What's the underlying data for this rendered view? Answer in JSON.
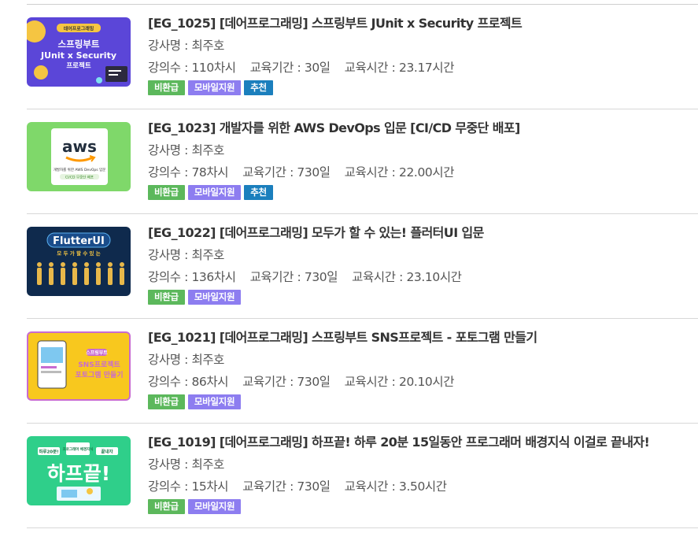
{
  "courses": [
    {
      "title": "[EG_1025] [데어프로그래밍] 스프링부트 JUnit x Security 프로젝트",
      "instructor": "강사명 : 최주호",
      "lessons": "강의수 : 110차시",
      "period": "교육기간 : 30일",
      "hours": "교육시간 : 23.17시간",
      "badges": [
        "비환급",
        "모바일지원",
        "추천"
      ],
      "thumb_text": [
        "데어프로그래밍",
        "스프링부트",
        "JUnit x Security",
        "프로젝트"
      ]
    },
    {
      "title": "[EG_1023] 개발자를 위한 AWS DevOps 입문 [CI/CD 무중단 배포]",
      "instructor": "강사명 : 최주호",
      "lessons": "강의수 : 78차시",
      "period": "교육기간 : 730일",
      "hours": "교육시간 : 22.00시간",
      "badges": [
        "비환급",
        "모바일지원",
        "추천"
      ],
      "thumb_text": [
        "aws",
        "개발자를 위한 AWS DevOps 입문",
        "CI/CD 무중단 배포"
      ]
    },
    {
      "title": "[EG_1022] [데어프로그래밍] 모두가 할 수 있는! 플러터UI 입문",
      "instructor": "강사명 : 최주호",
      "lessons": "강의수 : 136차시",
      "period": "교육기간 : 730일",
      "hours": "교육시간 : 23.10시간",
      "badges": [
        "비환급",
        "모바일지원"
      ],
      "thumb_text": [
        "FlutterUI",
        "모 두 가 할 수 있 는"
      ]
    },
    {
      "title": "[EG_1021] [데어프로그래밍] 스프링부트 SNS프로젝트 - 포토그램 만들기",
      "instructor": "강사명 : 최주호",
      "lessons": "강의수 : 86차시",
      "period": "교육기간 : 730일",
      "hours": "교육시간 : 20.10시간",
      "badges": [
        "비환급",
        "모바일지원"
      ],
      "thumb_text": [
        "스프링부트",
        "SNS프로젝트",
        "포토그램 만들기"
      ]
    },
    {
      "title": "[EG_1019] [데어프로그래밍] 하프끝! 하루 20분 15일동안 프로그래머 배경지식 이걸로 끝내자!",
      "instructor": "강사명 : 최주호",
      "lessons": "강의수 : 15차시",
      "period": "교육기간 : 730일",
      "hours": "교육시간 : 3.50시간",
      "badges": [
        "비환급",
        "모바일지원"
      ],
      "thumb_text": [
        "하루20분!",
        "프로그래머 배경지식",
        "끝내자",
        "하프끝!"
      ]
    }
  ],
  "badge_colors": {
    "비환급": "#5cb85c",
    "모바일지원": "#8d7df0",
    "추천": "#1b7fbd"
  }
}
